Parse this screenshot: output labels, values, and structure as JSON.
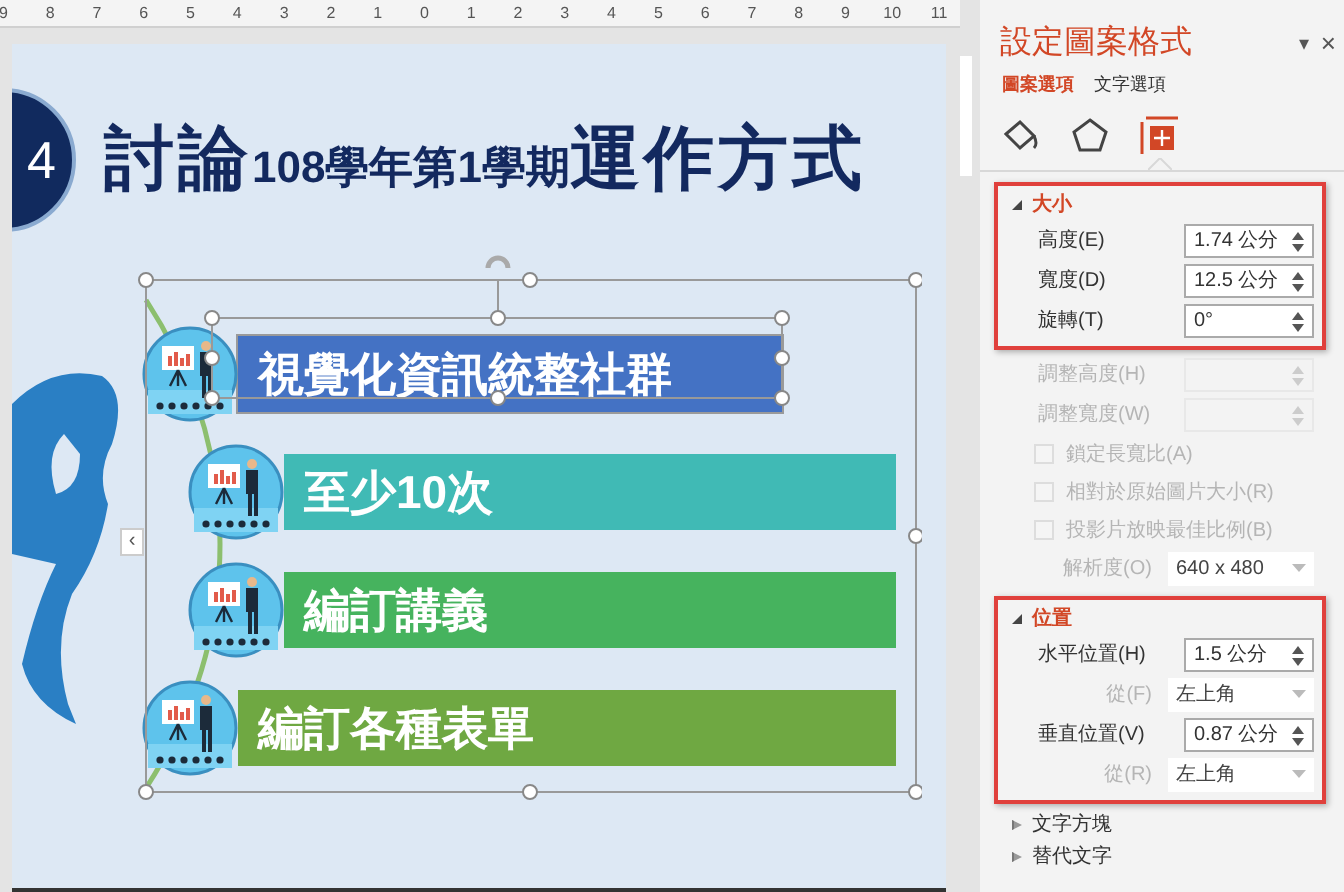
{
  "ruler": {
    "labels": [
      "9",
      "8",
      "7",
      "6",
      "5",
      "4",
      "3",
      "2",
      "1",
      "0",
      "1",
      "2",
      "3",
      "4",
      "5",
      "6",
      "7",
      "8",
      "9",
      "10",
      "11"
    ]
  },
  "slide": {
    "badge": "4",
    "title_parts": [
      {
        "text": "討論",
        "kind": "large"
      },
      {
        "text": "108學年第1學期",
        "kind": "small"
      },
      {
        "text": "運作方式",
        "kind": "large"
      }
    ],
    "collapse_glyph": "‹",
    "items": [
      {
        "text": "視覺化資訊統整社群",
        "color": "#4472c4",
        "selected": true
      },
      {
        "text": "至少10次",
        "color": "#40bab5",
        "selected": false
      },
      {
        "text": "編訂講義",
        "color": "#46b35e",
        "selected": false
      },
      {
        "text": "編訂各種表單",
        "color": "#6fa842",
        "selected": false
      }
    ]
  },
  "pane": {
    "title": "設定圖案格式",
    "menu_glyph": "▾",
    "close_glyph": "×",
    "tabs": [
      {
        "label": "圖案選項",
        "selected": true
      },
      {
        "label": "文字選項",
        "selected": false
      }
    ],
    "icons": [
      {
        "kind": "fill",
        "selected": false
      },
      {
        "kind": "shape",
        "selected": false
      },
      {
        "kind": "size",
        "selected": true
      }
    ],
    "sections": [
      {
        "title": "大小",
        "expanded": true,
        "highlighted": true,
        "rows": [
          {
            "kind": "spin",
            "label": "高度(E)",
            "value": "1.74 公分",
            "disabled": false
          },
          {
            "kind": "spin",
            "label": "寬度(D)",
            "value": "12.5 公分",
            "disabled": false
          },
          {
            "kind": "spin",
            "label": "旋轉(T)",
            "value": "0°",
            "disabled": false
          }
        ]
      },
      {
        "rows": [
          {
            "kind": "spin",
            "label": "調整高度(H)",
            "disabled": true
          },
          {
            "kind": "spin",
            "label": "調整寬度(W)",
            "disabled": true
          },
          {
            "kind": "checkbox",
            "label": "鎖定長寬比(A)",
            "checked": false,
            "disabled": true
          },
          {
            "kind": "checkbox",
            "label": "相對於原始圖片大小(R)",
            "checked": false,
            "disabled": true
          },
          {
            "kind": "checkbox",
            "label": "投影片放映最佳比例(B)",
            "checked": false,
            "disabled": true
          },
          {
            "kind": "dropdown",
            "label": "解析度(O)",
            "value": "640 x 480",
            "disabled": true
          }
        ]
      },
      {
        "title": "位置",
        "expanded": true,
        "highlighted": true,
        "rows": [
          {
            "kind": "spin",
            "label": "水平位置(H)",
            "value": "1.5 公分",
            "disabled": false
          },
          {
            "kind": "dropdown",
            "label": "從(F)",
            "value": "左上角",
            "disabled": true
          },
          {
            "kind": "spin",
            "label": "垂直位置(V)",
            "value": "0.87 公分",
            "disabled": false
          },
          {
            "kind": "dropdown",
            "label": "從(R)",
            "value": "左上角",
            "disabled": true
          }
        ]
      },
      {
        "title": "文字方塊",
        "expanded": false,
        "highlighted": false
      },
      {
        "title": "替代文字",
        "expanded": false,
        "highlighted": false
      }
    ]
  }
}
